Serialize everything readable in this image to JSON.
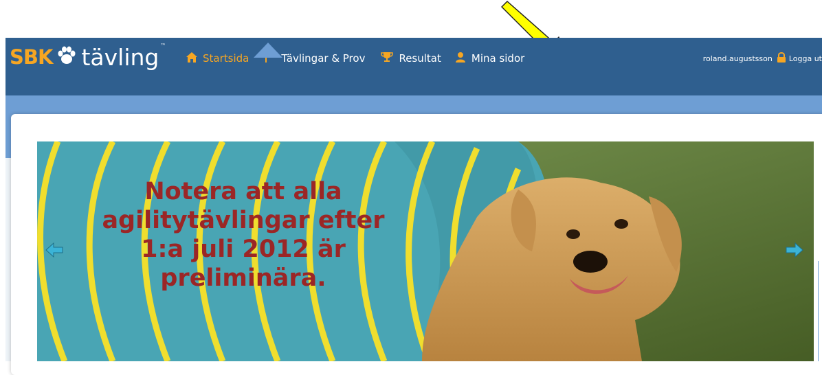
{
  "logo": {
    "brand": "SBK",
    "name": "tävling",
    "tm": "™"
  },
  "nav": {
    "items": [
      {
        "label": "Startsida",
        "icon": "home-icon",
        "active": true
      },
      {
        "label": "Tävlingar & Prov",
        "icon": "flag-icon",
        "active": false
      },
      {
        "label": "Resultat",
        "icon": "trophy-icon",
        "active": false
      },
      {
        "label": "Mina sidor",
        "icon": "user-icon",
        "active": false
      }
    ]
  },
  "user": {
    "name": "roland.augustsson",
    "logout_label": "Logga ut"
  },
  "banner": {
    "notice_lines": [
      "Notera att alla",
      "agilitytävlingar efter",
      "1:a juli 2012 är",
      "preliminära."
    ]
  },
  "colors": {
    "navbar": "#2f5f8f",
    "subbar": "#6e9ed4",
    "accent": "#f6a623",
    "notice_text": "#9b2626",
    "annotation_arrow": "#ffff00"
  }
}
